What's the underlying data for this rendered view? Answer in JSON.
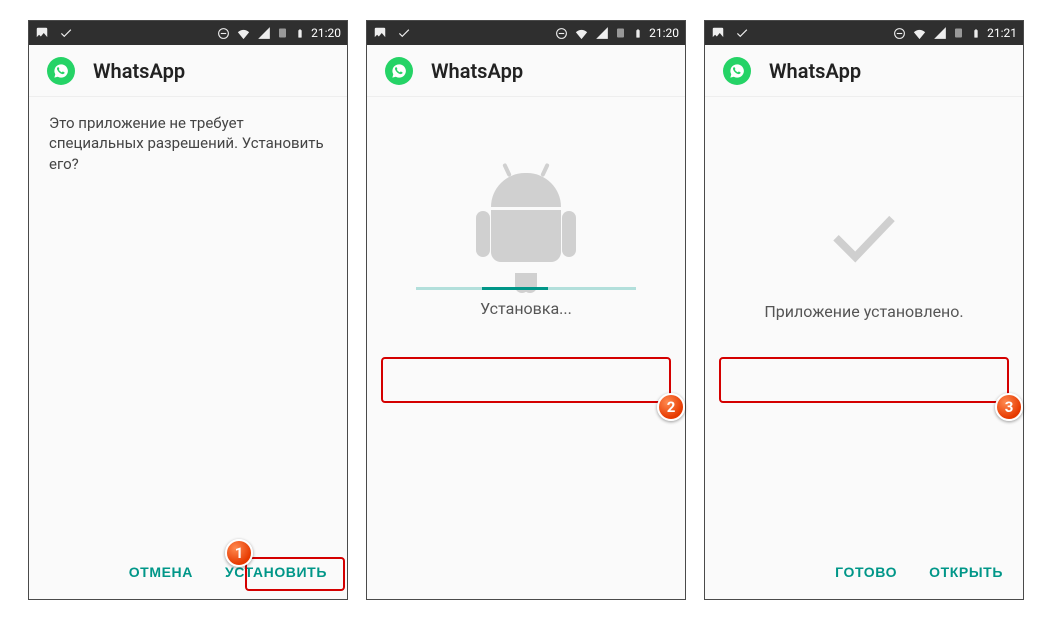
{
  "statusbar": {
    "time": "21:20",
    "time3": "21:21"
  },
  "app": {
    "name": "WhatsApp"
  },
  "screen1": {
    "message": "Это приложение не требует специальных разрешений. Установить его?",
    "cancel": "ОТМЕНА",
    "install": "УСТАНОВИТЬ",
    "badge": "1"
  },
  "screen2": {
    "installing": "Установка...",
    "badge": "2"
  },
  "screen3": {
    "installed": "Приложение установлено.",
    "done": "ГОТОВО",
    "open": "ОТКРЫТЬ",
    "badge": "3"
  },
  "colors": {
    "accent": "#009688",
    "whatsapp": "#25d366",
    "highlight": "#d40000"
  }
}
